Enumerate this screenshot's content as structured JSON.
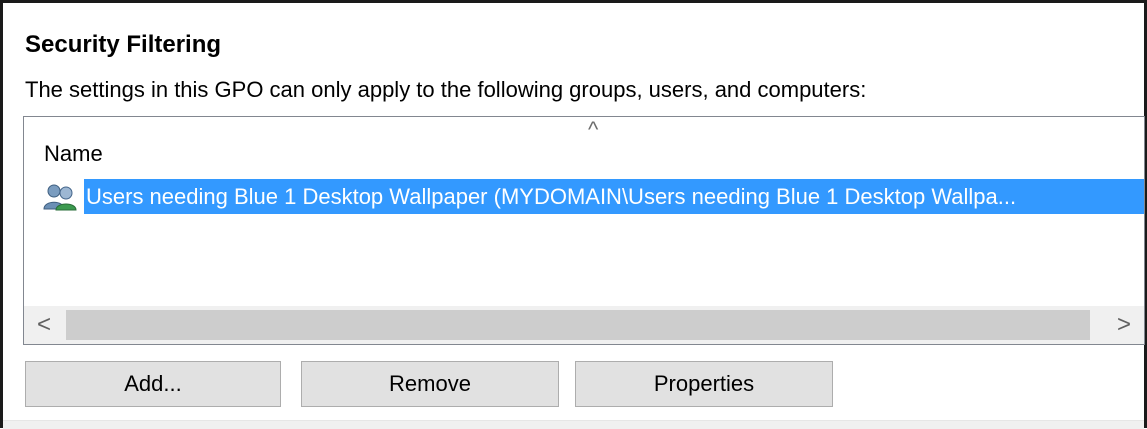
{
  "security_filtering": {
    "title": "Security Filtering",
    "description": "The settings in this GPO can only apply to the following groups, users, and computers:",
    "list": {
      "sort_indicator": "^",
      "columns": [
        "Name"
      ],
      "rows": [
        {
          "icon": "user-group-icon",
          "name": "Users needing Blue 1 Desktop Wallpaper (MYDOMAIN\\Users needing Blue 1 Desktop Wallpa...",
          "selected": true
        }
      ],
      "scroll_left": "<",
      "scroll_right": ">"
    },
    "buttons": {
      "add": "Add...",
      "remove": "Remove",
      "properties": "Properties"
    },
    "colors": {
      "selection": "#3399ff",
      "button_face": "#e1e1e1",
      "scrollbar_track": "#f0f0f0",
      "scrollbar_thumb": "#cdcdcd"
    }
  }
}
